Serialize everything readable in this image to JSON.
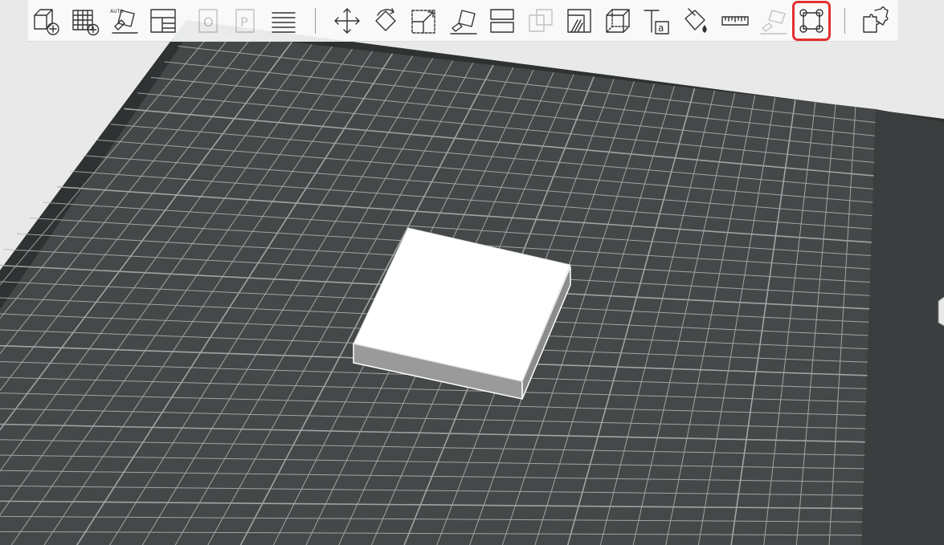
{
  "toolbar": {
    "tools": [
      {
        "id": "add-shape",
        "icon": "cube-plus-icon",
        "enabled": true,
        "highlighted": false
      },
      {
        "id": "add-grid",
        "icon": "grid-plus-icon",
        "enabled": true,
        "highlighted": false
      },
      {
        "id": "auto-arrange",
        "icon": "auto-place-icon",
        "label": "AUTO",
        "enabled": true,
        "highlighted": false
      },
      {
        "id": "layout-panels",
        "icon": "layout-icon",
        "enabled": true,
        "highlighted": false
      },
      {
        "id": "o-tool",
        "icon": "letter-o-icon",
        "label": "O",
        "enabled": false,
        "highlighted": false
      },
      {
        "id": "p-tool",
        "icon": "letter-p-icon",
        "label": "P",
        "enabled": false,
        "highlighted": false
      },
      {
        "id": "layers",
        "icon": "layers-stack-icon",
        "enabled": true,
        "highlighted": false
      },
      {
        "id": "move",
        "icon": "move-arrows-icon",
        "enabled": true,
        "highlighted": false
      },
      {
        "id": "rotate",
        "icon": "rotate-icon",
        "enabled": true,
        "highlighted": false
      },
      {
        "id": "scale",
        "icon": "scale-icon",
        "enabled": true,
        "highlighted": false
      },
      {
        "id": "lay-flat",
        "icon": "lay-flat-icon",
        "enabled": true,
        "highlighted": false
      },
      {
        "id": "split",
        "icon": "split-icon",
        "enabled": true,
        "highlighted": false
      },
      {
        "id": "merge",
        "icon": "merge-icon",
        "enabled": false,
        "highlighted": false
      },
      {
        "id": "hollow",
        "icon": "hollow-icon",
        "enabled": true,
        "highlighted": false
      },
      {
        "id": "box",
        "icon": "box-outline-icon",
        "enabled": true,
        "highlighted": false
      },
      {
        "id": "text",
        "icon": "text-icon",
        "label": "Ta",
        "enabled": true,
        "highlighted": false
      },
      {
        "id": "paint",
        "icon": "paint-bucket-icon",
        "enabled": true,
        "highlighted": false
      },
      {
        "id": "measure",
        "icon": "ruler-icon",
        "enabled": true,
        "highlighted": false
      },
      {
        "id": "support",
        "icon": "support-icon",
        "enabled": false,
        "highlighted": false
      },
      {
        "id": "fit-frame",
        "icon": "frame-corners-icon",
        "enabled": true,
        "highlighted": true
      },
      {
        "id": "puzzle",
        "icon": "puzzle-icon",
        "enabled": true,
        "highlighted": false
      }
    ]
  },
  "colors": {
    "plate": "#454848",
    "plate_border": "#2f3232",
    "grid_line": "#b2b5b5",
    "object_top": "#ffffff",
    "object_side": "#8c8c8c",
    "highlight": "#e53030",
    "background": "#e9e9e9"
  }
}
